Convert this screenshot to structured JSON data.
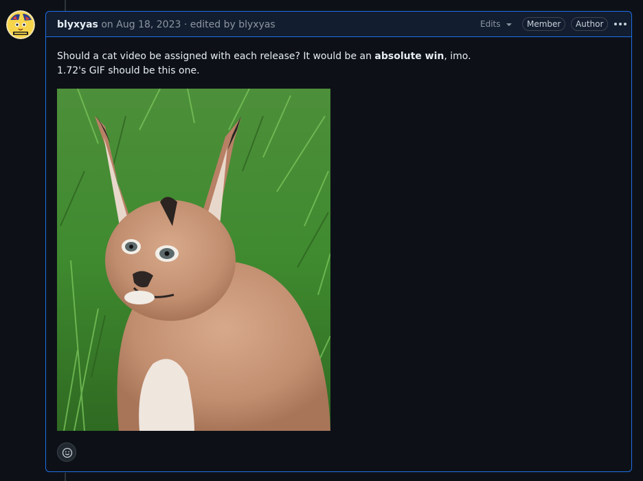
{
  "comment": {
    "author": "blyxyas",
    "date_prefix": "on",
    "date": "Aug 18, 2023",
    "separator": "·",
    "edited_prefix": "edited by",
    "edited_by": "blyxyas",
    "edits_label": "Edits",
    "badges": [
      "Member",
      "Author"
    ],
    "body": {
      "line1_before": "Should a cat video be assigned with each release? It would be an ",
      "line1_bold": "absolute win",
      "line1_after": ", imo.",
      "line2": "1.72's GIF should be this one."
    },
    "image_subject": "caracal kitten in grass"
  },
  "icons": {
    "menu": "kebab-horizontal-icon",
    "reaction": "smiley-icon",
    "dropdown": "triangle-down-icon"
  },
  "colors": {
    "background": "#0d1117",
    "header_bg": "#121d2f",
    "accent_border": "#1f6feb",
    "muted_text": "#8d96a0",
    "primary_text": "#e6edf3"
  }
}
